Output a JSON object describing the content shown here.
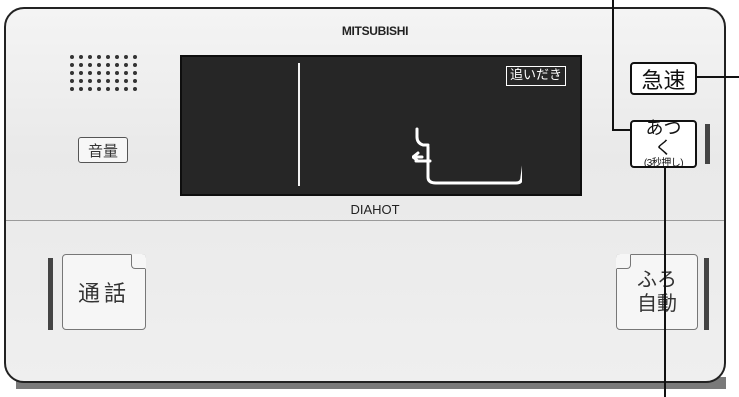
{
  "brand": "MITSUBISHI",
  "sub_brand": "DIAHOT",
  "display": {
    "mode_tag": "追いだき"
  },
  "buttons": {
    "volume": "音量",
    "kyusoku": "急速",
    "atsuku_main": "あつく",
    "atsuku_sub": "(3秒押し)",
    "tsuwa": "通話",
    "furo_line1": "ふろ",
    "furo_line2": "自動"
  },
  "colors": {
    "display_bg": "#262626",
    "panel_bg": "#efefef"
  }
}
